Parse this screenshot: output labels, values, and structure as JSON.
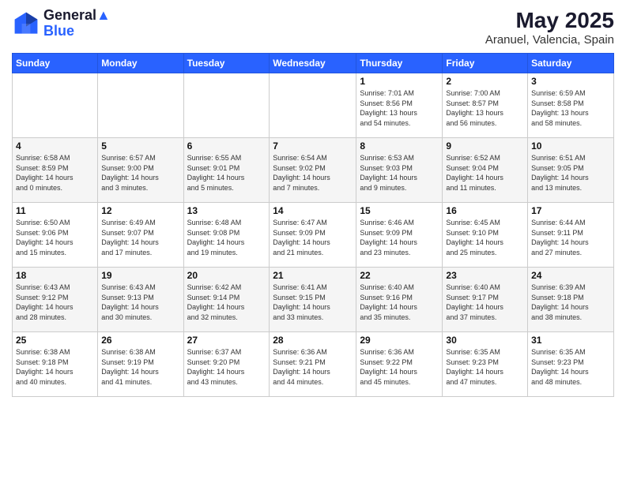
{
  "header": {
    "logo_line1": "General",
    "logo_line2": "Blue",
    "title": "May 2025",
    "subtitle": "Aranuel, Valencia, Spain"
  },
  "weekdays": [
    "Sunday",
    "Monday",
    "Tuesday",
    "Wednesday",
    "Thursday",
    "Friday",
    "Saturday"
  ],
  "weeks": [
    [
      {
        "day": "",
        "info": ""
      },
      {
        "day": "",
        "info": ""
      },
      {
        "day": "",
        "info": ""
      },
      {
        "day": "",
        "info": ""
      },
      {
        "day": "1",
        "info": "Sunrise: 7:01 AM\nSunset: 8:56 PM\nDaylight: 13 hours\nand 54 minutes."
      },
      {
        "day": "2",
        "info": "Sunrise: 7:00 AM\nSunset: 8:57 PM\nDaylight: 13 hours\nand 56 minutes."
      },
      {
        "day": "3",
        "info": "Sunrise: 6:59 AM\nSunset: 8:58 PM\nDaylight: 13 hours\nand 58 minutes."
      }
    ],
    [
      {
        "day": "4",
        "info": "Sunrise: 6:58 AM\nSunset: 8:59 PM\nDaylight: 14 hours\nand 0 minutes."
      },
      {
        "day": "5",
        "info": "Sunrise: 6:57 AM\nSunset: 9:00 PM\nDaylight: 14 hours\nand 3 minutes."
      },
      {
        "day": "6",
        "info": "Sunrise: 6:55 AM\nSunset: 9:01 PM\nDaylight: 14 hours\nand 5 minutes."
      },
      {
        "day": "7",
        "info": "Sunrise: 6:54 AM\nSunset: 9:02 PM\nDaylight: 14 hours\nand 7 minutes."
      },
      {
        "day": "8",
        "info": "Sunrise: 6:53 AM\nSunset: 9:03 PM\nDaylight: 14 hours\nand 9 minutes."
      },
      {
        "day": "9",
        "info": "Sunrise: 6:52 AM\nSunset: 9:04 PM\nDaylight: 14 hours\nand 11 minutes."
      },
      {
        "day": "10",
        "info": "Sunrise: 6:51 AM\nSunset: 9:05 PM\nDaylight: 14 hours\nand 13 minutes."
      }
    ],
    [
      {
        "day": "11",
        "info": "Sunrise: 6:50 AM\nSunset: 9:06 PM\nDaylight: 14 hours\nand 15 minutes."
      },
      {
        "day": "12",
        "info": "Sunrise: 6:49 AM\nSunset: 9:07 PM\nDaylight: 14 hours\nand 17 minutes."
      },
      {
        "day": "13",
        "info": "Sunrise: 6:48 AM\nSunset: 9:08 PM\nDaylight: 14 hours\nand 19 minutes."
      },
      {
        "day": "14",
        "info": "Sunrise: 6:47 AM\nSunset: 9:09 PM\nDaylight: 14 hours\nand 21 minutes."
      },
      {
        "day": "15",
        "info": "Sunrise: 6:46 AM\nSunset: 9:09 PM\nDaylight: 14 hours\nand 23 minutes."
      },
      {
        "day": "16",
        "info": "Sunrise: 6:45 AM\nSunset: 9:10 PM\nDaylight: 14 hours\nand 25 minutes."
      },
      {
        "day": "17",
        "info": "Sunrise: 6:44 AM\nSunset: 9:11 PM\nDaylight: 14 hours\nand 27 minutes."
      }
    ],
    [
      {
        "day": "18",
        "info": "Sunrise: 6:43 AM\nSunset: 9:12 PM\nDaylight: 14 hours\nand 28 minutes."
      },
      {
        "day": "19",
        "info": "Sunrise: 6:43 AM\nSunset: 9:13 PM\nDaylight: 14 hours\nand 30 minutes."
      },
      {
        "day": "20",
        "info": "Sunrise: 6:42 AM\nSunset: 9:14 PM\nDaylight: 14 hours\nand 32 minutes."
      },
      {
        "day": "21",
        "info": "Sunrise: 6:41 AM\nSunset: 9:15 PM\nDaylight: 14 hours\nand 33 minutes."
      },
      {
        "day": "22",
        "info": "Sunrise: 6:40 AM\nSunset: 9:16 PM\nDaylight: 14 hours\nand 35 minutes."
      },
      {
        "day": "23",
        "info": "Sunrise: 6:40 AM\nSunset: 9:17 PM\nDaylight: 14 hours\nand 37 minutes."
      },
      {
        "day": "24",
        "info": "Sunrise: 6:39 AM\nSunset: 9:18 PM\nDaylight: 14 hours\nand 38 minutes."
      }
    ],
    [
      {
        "day": "25",
        "info": "Sunrise: 6:38 AM\nSunset: 9:18 PM\nDaylight: 14 hours\nand 40 minutes."
      },
      {
        "day": "26",
        "info": "Sunrise: 6:38 AM\nSunset: 9:19 PM\nDaylight: 14 hours\nand 41 minutes."
      },
      {
        "day": "27",
        "info": "Sunrise: 6:37 AM\nSunset: 9:20 PM\nDaylight: 14 hours\nand 43 minutes."
      },
      {
        "day": "28",
        "info": "Sunrise: 6:36 AM\nSunset: 9:21 PM\nDaylight: 14 hours\nand 44 minutes."
      },
      {
        "day": "29",
        "info": "Sunrise: 6:36 AM\nSunset: 9:22 PM\nDaylight: 14 hours\nand 45 minutes."
      },
      {
        "day": "30",
        "info": "Sunrise: 6:35 AM\nSunset: 9:23 PM\nDaylight: 14 hours\nand 47 minutes."
      },
      {
        "day": "31",
        "info": "Sunrise: 6:35 AM\nSunset: 9:23 PM\nDaylight: 14 hours\nand 48 minutes."
      }
    ]
  ]
}
